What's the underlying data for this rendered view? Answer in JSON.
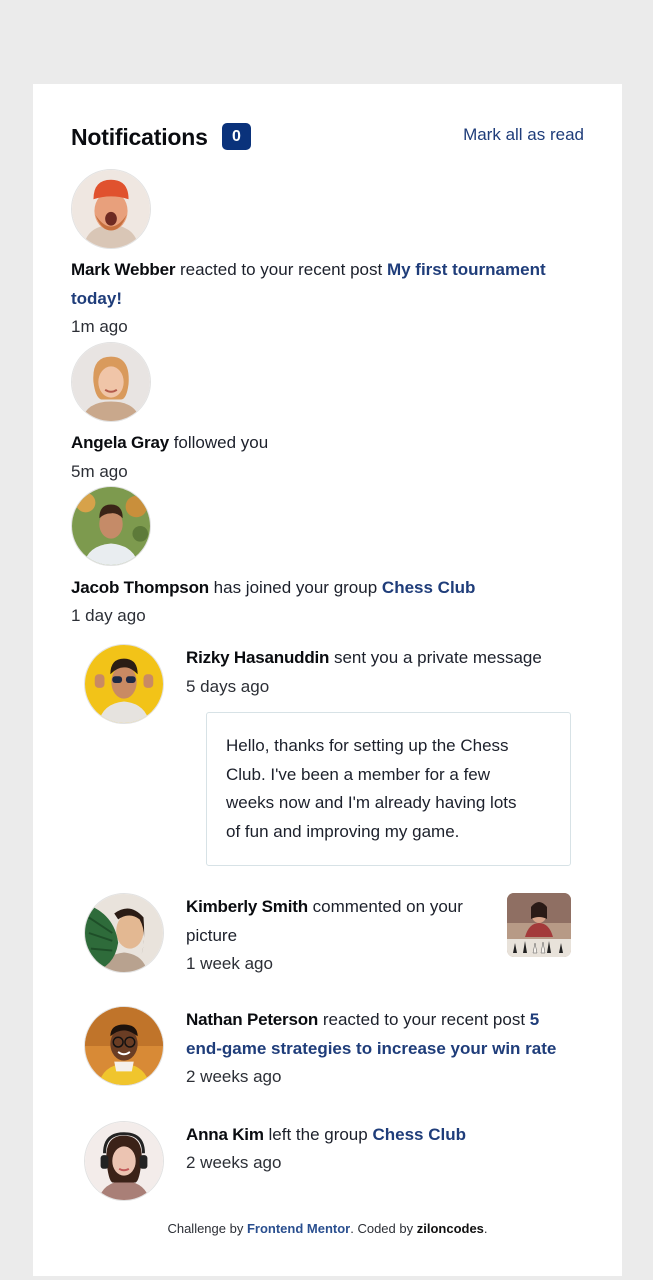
{
  "header": {
    "title": "Notifications",
    "unread_count": "0",
    "mark_all_label": "Mark all as read"
  },
  "notifications": [
    {
      "name": "Mark Webber",
      "action": "reacted to your recent post",
      "target_part1": "My first tournament",
      "target_part2": "today!",
      "time": "1m ago",
      "avatar": "mark-webber-avatar"
    },
    {
      "name": "Angela Gray",
      "action": "followed you",
      "time": "5m ago",
      "avatar": "angela-gray-avatar"
    },
    {
      "name": "Jacob Thompson",
      "action": "has joined your group",
      "target": "Chess Club",
      "time": "1 day ago",
      "avatar": "jacob-thompson-avatar"
    },
    {
      "name": "Rizky Hasanuddin",
      "action": "sent you a private message",
      "time": "5 days ago",
      "avatar": "rizky-hasanuddin-avatar",
      "message_lines": [
        "Hello, thanks for setting up the Chess",
        "Club. I've been a member for a few",
        "weeks now and I'm already having lots",
        "of fun and improving my game."
      ]
    },
    {
      "name": "Kimberly Smith",
      "action": "commented on your",
      "action_line2": "picture",
      "time": "1 week ago",
      "avatar": "kimberly-smith-avatar",
      "thumbnail": "chess-picture-thumbnail"
    },
    {
      "name": "Nathan Peterson",
      "action": "reacted to your recent post",
      "target_part1": "5",
      "target_part2": "end-game strategies to increase your win rate",
      "time": "2 weeks ago",
      "avatar": "nathan-peterson-avatar"
    },
    {
      "name": "Anna Kim",
      "action": "left the group",
      "target": "Chess Club",
      "time": "2 weeks ago",
      "avatar": "anna-kim-avatar"
    }
  ],
  "footer": {
    "prefix": "Challenge by",
    "link": "Frontend Mentor",
    "middle": ". Coded by",
    "author": "ziloncodes",
    "suffix": "."
  },
  "colors": {
    "page_bg": "#ebebeb",
    "card_bg": "#ffffff",
    "badge_bg": "#0a327b",
    "link": "#1f3d7a"
  }
}
